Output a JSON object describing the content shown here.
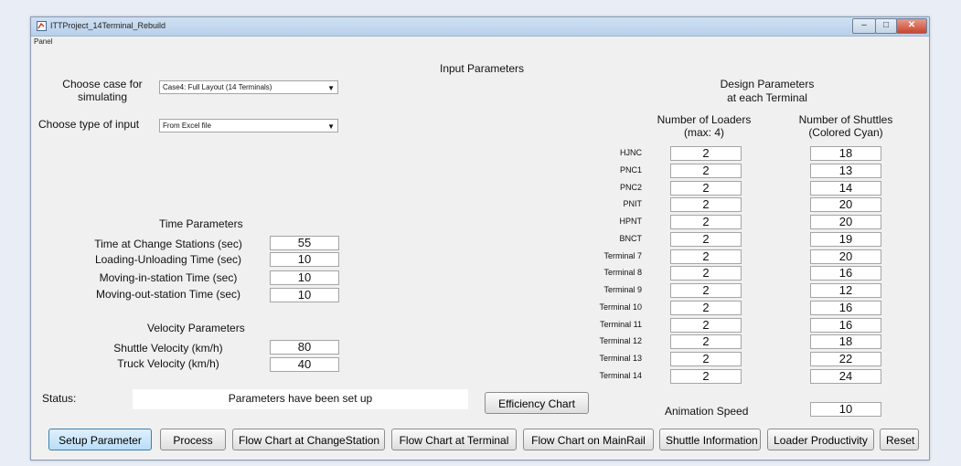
{
  "window": {
    "title": "ITTProject_14Terminal_Rebuild",
    "panel_label": "Panel"
  },
  "input_params_title": "Input Parameters",
  "case": {
    "label": "Choose case for simulating",
    "value": "Case4: Full Layout (14 Terminals)"
  },
  "input_type": {
    "label": "Choose type of input",
    "value": "From Excel file"
  },
  "time": {
    "title": "Time Parameters",
    "rows": [
      {
        "label": "Time at Change Stations (sec)",
        "value": "55"
      },
      {
        "label": "Loading-Unloading Time (sec)",
        "value": "10"
      },
      {
        "label": "Moving-in-station Time (sec)",
        "value": "10"
      },
      {
        "label": "Moving-out-station Time (sec)",
        "value": "10"
      }
    ]
  },
  "velocity": {
    "title": "Velocity Parameters",
    "rows": [
      {
        "label": "Shuttle Velocity (km/h)",
        "value": "80"
      },
      {
        "label": "Truck Velocity (km/h)",
        "value": "40"
      }
    ]
  },
  "status": {
    "label": "Status:",
    "text": "Parameters have been set up"
  },
  "design": {
    "title_line1": "Design Parameters",
    "title_line2": "at each Terminal",
    "loaders_header_1": "Number of Loaders",
    "loaders_header_2": "(max: 4)",
    "shuttles_header_1": "Number of Shuttles",
    "shuttles_header_2": "(Colored Cyan)",
    "terminals": [
      {
        "name": "HJNC",
        "loaders": "2",
        "shuttles": "18"
      },
      {
        "name": "PNC1",
        "loaders": "2",
        "shuttles": "13"
      },
      {
        "name": "PNC2",
        "loaders": "2",
        "shuttles": "14"
      },
      {
        "name": "PNIT",
        "loaders": "2",
        "shuttles": "20"
      },
      {
        "name": "HPNT",
        "loaders": "2",
        "shuttles": "20"
      },
      {
        "name": "BNCT",
        "loaders": "2",
        "shuttles": "19"
      },
      {
        "name": "Terminal 7",
        "loaders": "2",
        "shuttles": "20"
      },
      {
        "name": "Terminal 8",
        "loaders": "2",
        "shuttles": "16"
      },
      {
        "name": "Terminal 9",
        "loaders": "2",
        "shuttles": "12"
      },
      {
        "name": "Terminal 10",
        "loaders": "2",
        "shuttles": "16"
      },
      {
        "name": "Terminal 11",
        "loaders": "2",
        "shuttles": "16"
      },
      {
        "name": "Terminal 12",
        "loaders": "2",
        "shuttles": "18"
      },
      {
        "name": "Terminal 13",
        "loaders": "2",
        "shuttles": "22"
      },
      {
        "name": "Terminal 14",
        "loaders": "2",
        "shuttles": "24"
      }
    ]
  },
  "animation": {
    "label": "Animation Speed",
    "value": "10"
  },
  "buttons": {
    "efficiency_chart": "Efficiency Chart",
    "setup": "Setup Parameter",
    "process": "Process",
    "flow_change": "Flow Chart at ChangeStation",
    "flow_terminal": "Flow Chart at Terminal",
    "flow_mainrail": "Flow Chart on MainRail",
    "shuttle_info": "Shuttle Information",
    "loader_prod": "Loader Productivity",
    "reset": "Reset"
  },
  "icons": {
    "window_icon": "matlab-figure-icon",
    "minimize": "minimize-icon",
    "maximize": "maximize-icon",
    "close": "close-icon"
  },
  "colors": {
    "window_bg": "#f0f0f0",
    "active_button": "#b8def8",
    "titlebar": "#cfe0f3"
  }
}
